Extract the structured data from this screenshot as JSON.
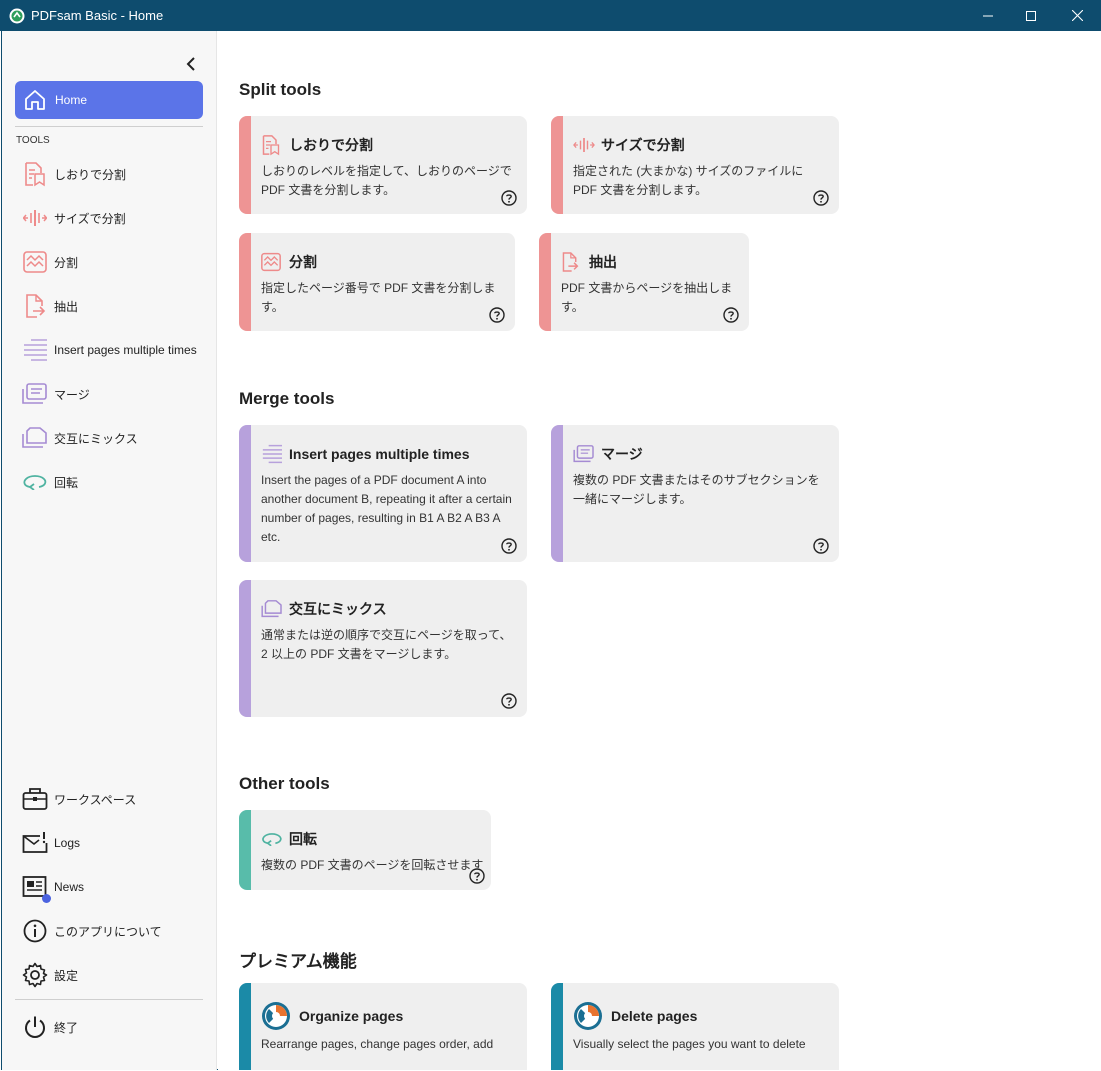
{
  "window": {
    "title": "PDFsam Basic - Home"
  },
  "sidebar": {
    "home_label": "Home",
    "tools_heading": "TOOLS",
    "tools": [
      {
        "label": "しおりで分割",
        "icon": "split-bookmarks-icon"
      },
      {
        "label": "サイズで分割",
        "icon": "split-size-icon"
      },
      {
        "label": "分割",
        "icon": "split-icon"
      },
      {
        "label": "抽出",
        "icon": "extract-icon"
      },
      {
        "label": "Insert pages multiple times",
        "icon": "insert-pages-icon"
      },
      {
        "label": "マージ",
        "icon": "merge-icon"
      },
      {
        "label": "交互にミックス",
        "icon": "alternate-mix-icon"
      },
      {
        "label": "回転",
        "icon": "rotate-icon"
      }
    ],
    "bottom": [
      {
        "label": "ワークスペース",
        "icon": "briefcase-icon"
      },
      {
        "label": "Logs",
        "icon": "logs-icon"
      },
      {
        "label": "News",
        "icon": "news-icon"
      },
      {
        "label": "このアプリについて",
        "icon": "info-icon"
      },
      {
        "label": "設定",
        "icon": "gear-icon"
      }
    ],
    "exit_label": "終了"
  },
  "sections": {
    "split": "Split tools",
    "merge": "Merge tools",
    "other": "Other tools",
    "premium": "プレミアム機能"
  },
  "cards": {
    "split_bookmarks": {
      "title": "しおりで分割",
      "desc": "しおりのレベルを指定して、しおりのページで PDF 文書を分割します。"
    },
    "split_size": {
      "title": "サイズで分割",
      "desc": "指定された (大まかな) サイズのファイルに PDF 文書を分割します。"
    },
    "split": {
      "title": "分割",
      "desc": "指定したページ番号で PDF 文書を分割します。"
    },
    "extract": {
      "title": "抽出",
      "desc": "PDF 文書からページを抽出します。"
    },
    "insert_pages": {
      "title": "Insert pages multiple times",
      "desc": "Insert the pages of a PDF document A into another document B, repeating it after a certain number of pages, resulting in B1 A B2 A B3 A etc."
    },
    "merge": {
      "title": "マージ",
      "desc": "複数の PDF 文書またはそのサブセクションを一緒にマージします。"
    },
    "alternate_mix": {
      "title": "交互にミックス",
      "desc": "通常または逆の順序で交互にページを取って、2 以上の PDF 文書をマージします。"
    },
    "rotate": {
      "title": "回転",
      "desc": "複数の PDF 文書のページを回転させます"
    },
    "organize": {
      "title": "Organize pages",
      "desc": "Rearrange pages, change pages order, add"
    },
    "delete_pages": {
      "title": "Delete pages",
      "desc": "Visually select the pages you want to delete"
    }
  },
  "colors": {
    "titlebar": "#0e4c6e",
    "accent": "#5b74e8",
    "split": "#ee9494",
    "merge": "#b7a1dc",
    "other": "#58bcaa",
    "premium": "#1b8aa7"
  }
}
